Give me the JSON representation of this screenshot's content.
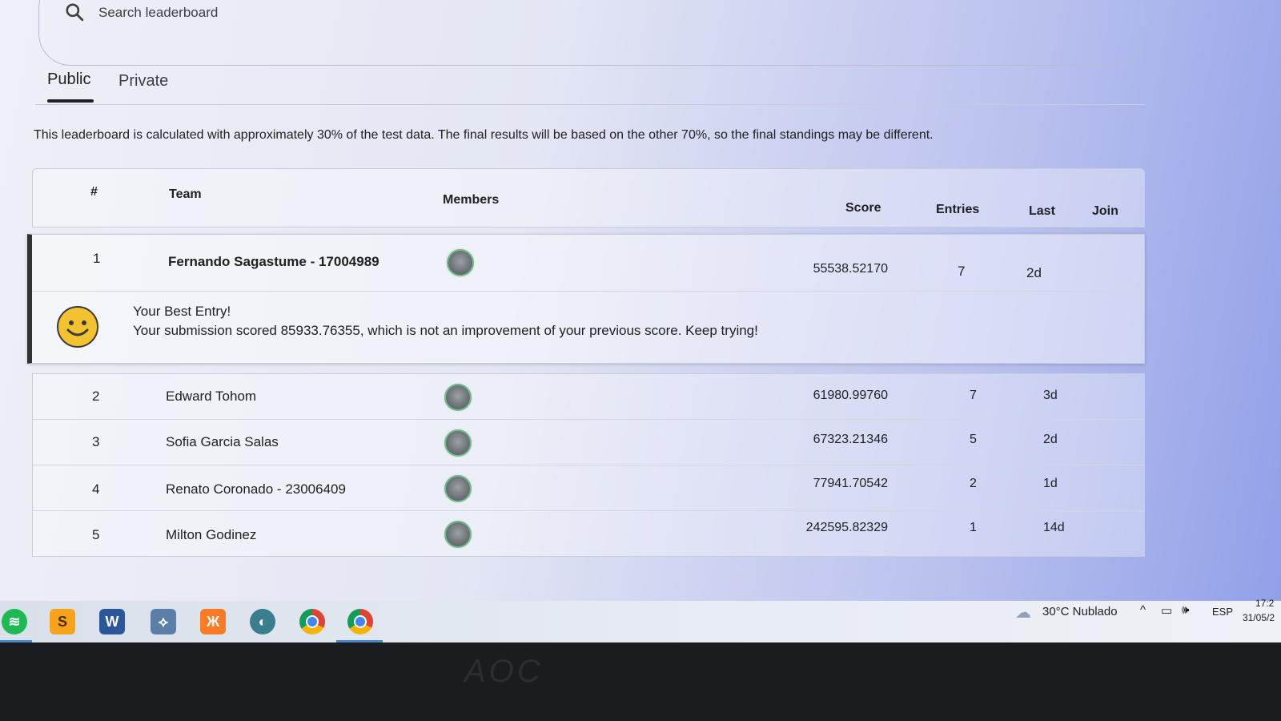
{
  "search": {
    "placeholder": "Search leaderboard"
  },
  "tabs": [
    {
      "label": "Public",
      "active": true
    },
    {
      "label": "Private",
      "active": false
    }
  ],
  "notice": "This leaderboard is calculated with approximately 30% of the test data. The final results will be based on the other 70%, so the final standings may be different.",
  "table": {
    "headers": {
      "rank": "#",
      "team": "Team",
      "members": "Members",
      "score": "Score",
      "entries": "Entries",
      "last": "Last",
      "join": "Join"
    },
    "highlight": {
      "rank": "1",
      "team": "Fernando Sagastume - 17004989",
      "score": "55538.52170",
      "entries": "7",
      "last": "2d",
      "best_title": "Your Best Entry!",
      "best_message": "Your submission scored 85933.76355, which is not an improvement of your previous score. Keep trying!"
    },
    "rows": [
      {
        "rank": "2",
        "team": "Edward Tohom",
        "score": "61980.99760",
        "entries": "7",
        "last": "3d"
      },
      {
        "rank": "3",
        "team": "Sofia Garcia Salas",
        "score": "67323.21346",
        "entries": "5",
        "last": "2d"
      },
      {
        "rank": "4",
        "team": "Renato Coronado - 23006409",
        "score": "77941.70542",
        "entries": "2",
        "last": "1d"
      },
      {
        "rank": "5",
        "team": "Milton Godinez",
        "score": "242595.82329",
        "entries": "1",
        "last": "14d"
      }
    ]
  },
  "taskbar": {
    "apps": [
      "spotify-icon",
      "sublime-text-icon",
      "word-icon",
      "mysql-workbench-icon",
      "xampp-icon",
      "browser-globe-icon",
      "chrome-icon",
      "chrome-icon"
    ],
    "weather": "30°C  Nublado",
    "language": "ESP",
    "time": "17:2",
    "date": "31/05/2"
  },
  "bezel_logo": "AOC"
}
